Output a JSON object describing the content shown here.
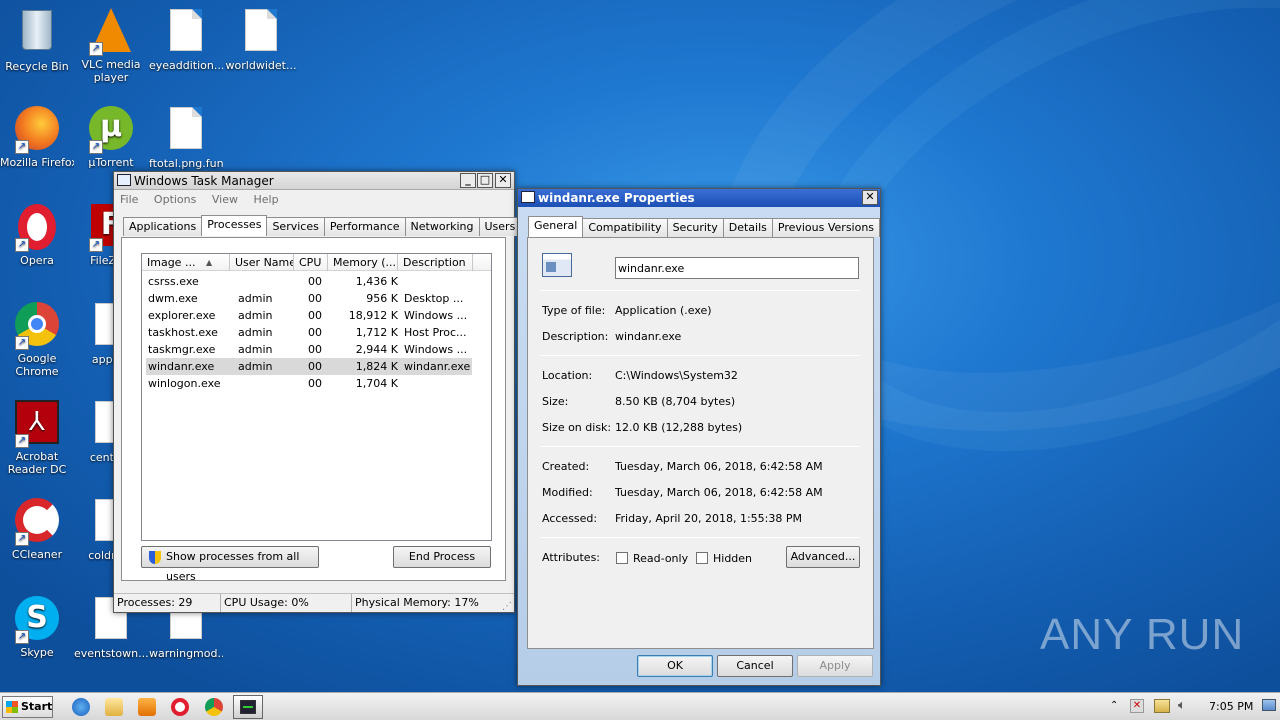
{
  "desktop": {
    "icons": [
      {
        "label": "Recycle Bin",
        "label2": "",
        "icon": "recycle-bin-icon"
      },
      {
        "label": "VLC media",
        "label2": "player",
        "icon": "vlc-icon"
      },
      {
        "label": "eyeaddition...",
        "label2": "",
        "icon": "file-icon"
      },
      {
        "label": "worldwidet...",
        "label2": "",
        "icon": "file-icon"
      },
      {
        "label": "Mozilla Firefox",
        "label2": "",
        "icon": "firefox-icon"
      },
      {
        "label": "µTorrent",
        "label2": "",
        "icon": "utorrent-icon"
      },
      {
        "label": "ftotal.png.fun",
        "label2": "",
        "icon": "file-icon"
      },
      {
        "label": "Opera",
        "label2": "",
        "icon": "opera-icon"
      },
      {
        "label": "FileZilla",
        "label2": "",
        "icon": "filezilla-icon"
      },
      {
        "label": "Google",
        "label2": "Chrome",
        "icon": "chrome-icon"
      },
      {
        "label": "approv",
        "label2": "",
        "icon": "file-icon"
      },
      {
        "label": "Acrobat",
        "label2": "Reader DC",
        "icon": "acrobat-icon"
      },
      {
        "label": "centerb",
        "label2": "",
        "icon": "file-icon"
      },
      {
        "label": "CCleaner",
        "label2": "",
        "icon": "ccleaner-icon"
      },
      {
        "label": "coldnew",
        "label2": "",
        "icon": "file-icon"
      },
      {
        "label": "Skype",
        "label2": "",
        "icon": "skype-icon"
      },
      {
        "label": "eventstown...",
        "label2": "",
        "icon": "file-icon"
      },
      {
        "label": "warningmod...",
        "label2": "",
        "icon": "file-icon"
      }
    ],
    "watermark": "ANY RUN"
  },
  "taskmgr": {
    "title": "Windows Task Manager",
    "menu": [
      "File",
      "Options",
      "View",
      "Help"
    ],
    "tabs": [
      "Applications",
      "Processes",
      "Services",
      "Performance",
      "Networking",
      "Users"
    ],
    "columns": [
      "Image ...",
      "User Name",
      "CPU",
      "Memory (...",
      "Description"
    ],
    "rows": [
      {
        "image": "csrss.exe",
        "user": "",
        "cpu": "00",
        "mem": "1,436 K",
        "desc": ""
      },
      {
        "image": "dwm.exe",
        "user": "admin",
        "cpu": "00",
        "mem": "956 K",
        "desc": "Desktop ..."
      },
      {
        "image": "explorer.exe",
        "user": "admin",
        "cpu": "00",
        "mem": "18,912 K",
        "desc": "Windows ..."
      },
      {
        "image": "taskhost.exe",
        "user": "admin",
        "cpu": "00",
        "mem": "1,712 K",
        "desc": "Host Proc..."
      },
      {
        "image": "taskmgr.exe",
        "user": "admin",
        "cpu": "00",
        "mem": "2,944 K",
        "desc": "Windows ..."
      },
      {
        "image": "windanr.exe",
        "user": "admin",
        "cpu": "00",
        "mem": "1,824 K",
        "desc": "windanr.exe"
      },
      {
        "image": "winlogon.exe",
        "user": "",
        "cpu": "00",
        "mem": "1,704 K",
        "desc": ""
      }
    ],
    "show_all_btn": "Show processes from all users",
    "end_btn": "End Process",
    "status": {
      "processes": "Processes: 29",
      "cpu": "CPU Usage: 0%",
      "mem": "Physical Memory: 17%"
    }
  },
  "props": {
    "title": "windanr.exe Properties",
    "tabs": [
      "General",
      "Compatibility",
      "Security",
      "Details",
      "Previous Versions"
    ],
    "filename": "windanr.exe",
    "fields": {
      "type_label": "Type of file:",
      "type": "Application (.exe)",
      "desc_label": "Description:",
      "desc": "windanr.exe",
      "loc_label": "Location:",
      "loc": "C:\\Windows\\System32",
      "size_label": "Size:",
      "size": "8.50 KB (8,704 bytes)",
      "disk_label": "Size on disk:",
      "disk": "12.0 KB (12,288 bytes)",
      "created_label": "Created:",
      "created": "Tuesday, March 06, 2018, 6:42:58 AM",
      "modified_label": "Modified:",
      "modified": "Tuesday, March 06, 2018, 6:42:58 AM",
      "accessed_label": "Accessed:",
      "accessed": "Friday, April 20, 2018, 1:55:38 PM",
      "attr_label": "Attributes:",
      "readonly": "Read-only",
      "hidden": "Hidden"
    },
    "advanced_btn": "Advanced...",
    "ok": "OK",
    "cancel": "Cancel",
    "apply": "Apply"
  },
  "taskbar": {
    "start": "Start",
    "time": "7:05 PM"
  }
}
